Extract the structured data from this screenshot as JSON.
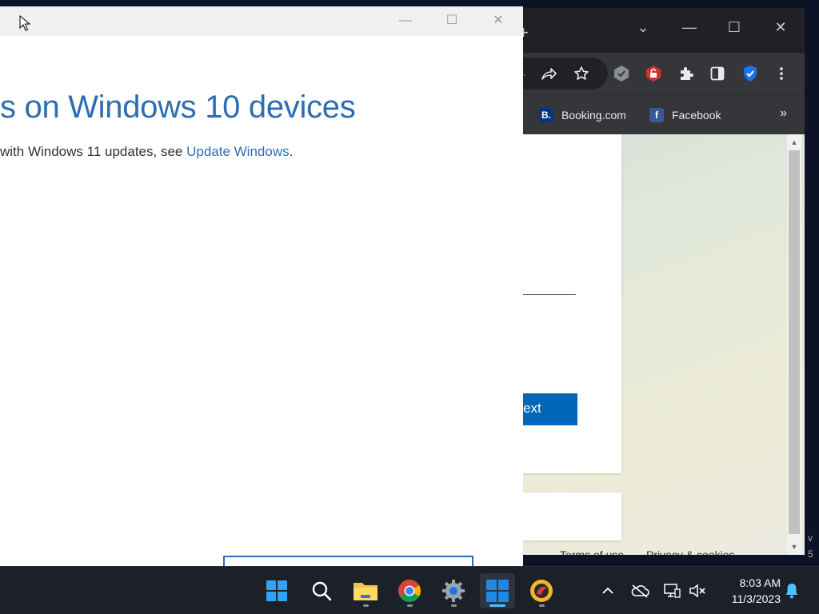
{
  "update_window": {
    "heading": "s on Windows 10 devices",
    "subtext_prefix": " with Windows 11 updates, see ",
    "subtext_link": "Update Windows",
    "subtext_suffix": ".",
    "controls": {
      "minimize": "—",
      "maximize": "☐",
      "close": "✕"
    }
  },
  "browser": {
    "new_tab": "+",
    "controls": {
      "tab_search": "⌄",
      "minimize": "—",
      "maximize": "☐",
      "close": "✕"
    },
    "url_tail": "..",
    "bookmarks": [
      {
        "label": "Booking.com",
        "icon_letter": "B.",
        "icon_color": "#003580"
      },
      {
        "label": "Facebook",
        "icon_letter": "f",
        "icon_color": "#3b5998"
      }
    ],
    "bookmarks_more": "»",
    "page": {
      "next_button": "Next",
      "next_visible": "ext",
      "footer_terms": "Terms of use",
      "footer_privacy": "Privacy & cookies",
      "footer_more": "..."
    }
  },
  "edge_text": {
    "line1": "v",
    "line2": "5"
  },
  "taskbar": {
    "apps": [
      "start",
      "search",
      "file-explorer",
      "chrome",
      "settings",
      "windows-update",
      "avast"
    ],
    "clock_time": "8:03 AM",
    "clock_date": "11/3/2023"
  },
  "colors": {
    "accent_blue": "#2c6eb1",
    "button_blue": "#0067b8",
    "taskbar_bg": "#1c2029",
    "chrome_dark": "#35363a"
  }
}
